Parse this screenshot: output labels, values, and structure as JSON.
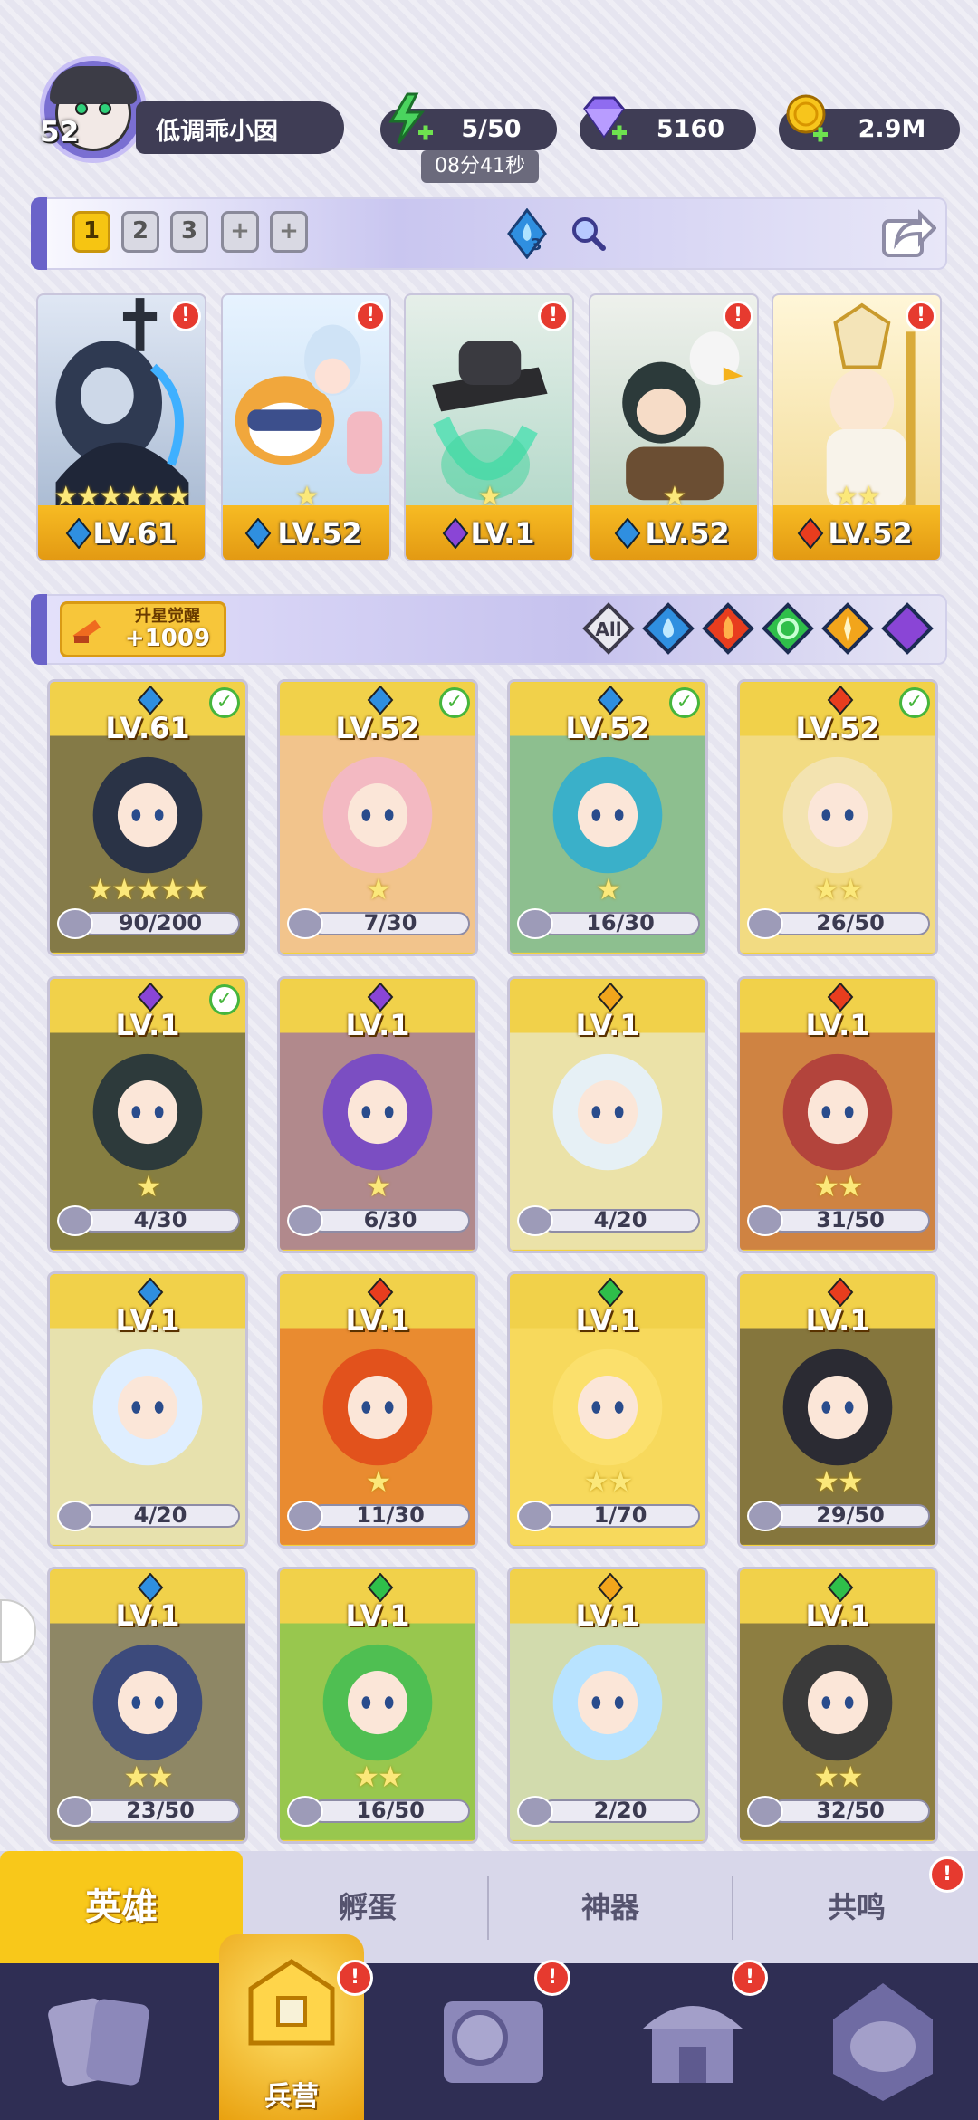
{
  "player": {
    "level": "52",
    "name": "低调乖小囡"
  },
  "resources": {
    "energy": "5/50",
    "energy_timer": "08分41秒",
    "gems": "5160",
    "coins": "2.9M"
  },
  "team_tabs": [
    "1",
    "2",
    "3"
  ],
  "team_badge": "3",
  "team": [
    {
      "level": "LV.61",
      "element": "water",
      "stars": 6
    },
    {
      "level": "LV.52",
      "element": "water",
      "stars": 1
    },
    {
      "level": "LV.1",
      "element": "dark",
      "stars": 1
    },
    {
      "level": "LV.52",
      "element": "water",
      "stars": 1
    },
    {
      "level": "LV.52",
      "element": "fire",
      "stars": 2
    }
  ],
  "awaken": {
    "label": "升星觉醒",
    "value": "+1009"
  },
  "filters": {
    "all_label": "All",
    "elements": [
      "water",
      "fire",
      "wind",
      "light",
      "dark"
    ]
  },
  "heroes": [
    {
      "level": "LV.61",
      "element": "water",
      "fragments": "90/200",
      "checked": true,
      "stars": 5
    },
    {
      "level": "LV.52",
      "element": "water",
      "fragments": "7/30",
      "checked": true,
      "stars": 1
    },
    {
      "level": "LV.52",
      "element": "water",
      "fragments": "16/30",
      "checked": true,
      "stars": 1
    },
    {
      "level": "LV.52",
      "element": "fire",
      "fragments": "26/50",
      "checked": true,
      "stars": 2
    },
    {
      "level": "LV.1",
      "element": "dark",
      "fragments": "4/30",
      "checked": true,
      "stars": 1
    },
    {
      "level": "LV.1",
      "element": "dark",
      "fragments": "6/30",
      "checked": false,
      "stars": 1
    },
    {
      "level": "LV.1",
      "element": "light",
      "fragments": "4/20",
      "checked": false,
      "stars": 0
    },
    {
      "level": "LV.1",
      "element": "fire",
      "fragments": "31/50",
      "checked": false,
      "stars": 2
    },
    {
      "level": "LV.1",
      "element": "water",
      "fragments": "4/20",
      "checked": false,
      "stars": 0
    },
    {
      "level": "LV.1",
      "element": "fire",
      "fragments": "11/30",
      "checked": false,
      "stars": 1
    },
    {
      "level": "LV.1",
      "element": "wind",
      "fragments": "1/70",
      "checked": false,
      "stars": 2
    },
    {
      "level": "LV.1",
      "element": "fire",
      "fragments": "29/50",
      "checked": false,
      "stars": 2
    },
    {
      "level": "LV.1",
      "element": "water",
      "fragments": "23/50",
      "checked": false,
      "stars": 2
    },
    {
      "level": "LV.1",
      "element": "wind",
      "fragments": "16/50",
      "checked": false,
      "stars": 2
    },
    {
      "level": "LV.1",
      "element": "light",
      "fragments": "2/20",
      "checked": false,
      "stars": 0
    },
    {
      "level": "LV.1",
      "element": "wind",
      "fragments": "32/50",
      "checked": false,
      "stars": 2
    }
  ],
  "tabs": [
    "英雄",
    "孵蛋",
    "神器",
    "共鸣"
  ],
  "nav": {
    "active_label": "兵营"
  },
  "colors": {
    "water": "#2f8fe0",
    "fire": "#e83d1e",
    "wind": "#2fbf4a",
    "light": "#f2a51b",
    "dark": "#8a45d6",
    "accent": "#f8c81a"
  }
}
